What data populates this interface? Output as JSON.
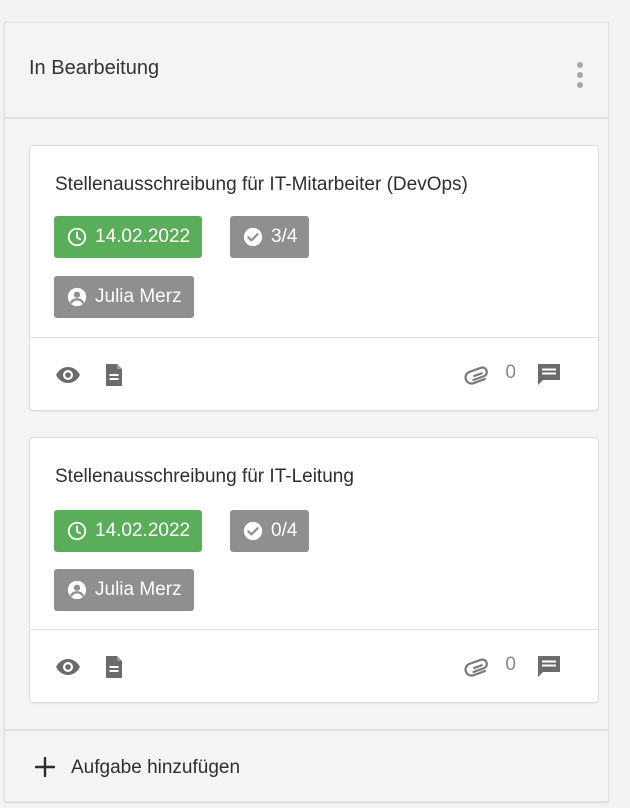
{
  "column": {
    "title": "In Bearbeitung",
    "menu_icon": "more-vert-icon",
    "add_task_label": "Aufgabe hinzufügen",
    "add_icon": "plus-icon"
  },
  "cards": [
    {
      "title": "Stellenausschreibung für IT-Mitarbeiter (DevOps)",
      "due_date": "14.02.2022",
      "checklist": "3/4",
      "assignee": "Julia Merz",
      "attachments": "0"
    },
    {
      "title": "Stellenausschreibung für IT-Leitung",
      "due_date": "14.02.2022",
      "checklist": "0/4",
      "assignee": "Julia Merz",
      "attachments": "0"
    }
  ],
  "colors": {
    "due_chip": "#5aae5a",
    "neutral_chip": "#8f8f8f",
    "icon": "#6b6b6b"
  }
}
